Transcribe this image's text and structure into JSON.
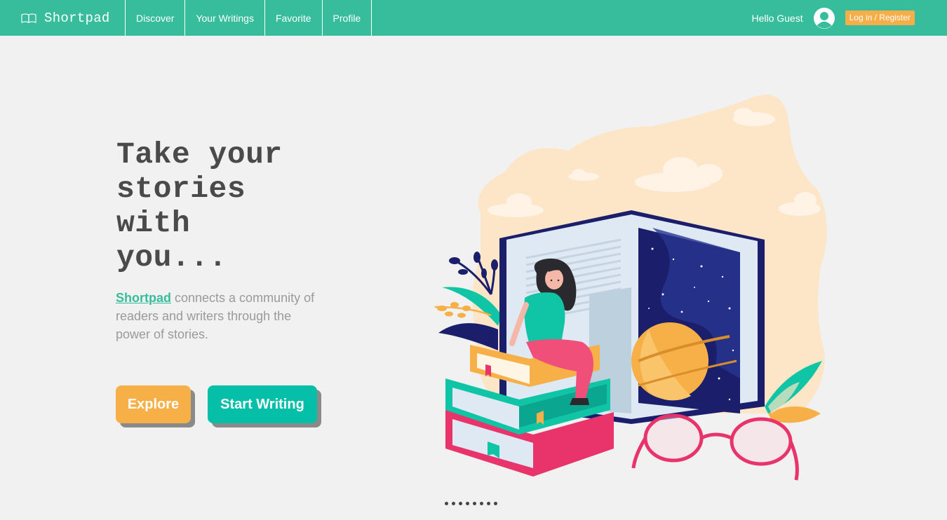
{
  "navbar": {
    "brand": "Shortpad",
    "brand_icon": "open-book-icon",
    "links": [
      "Discover",
      "Your Writings",
      "Favorite",
      "Profile"
    ],
    "greeting": "Hello Guest",
    "avatar_icon": "user-avatar-icon",
    "login_label": "Log in / Register",
    "accent_color": "#37bd9b",
    "login_color": "#f7ae48"
  },
  "hero": {
    "title_lines": [
      "Take your",
      "stories",
      "with",
      "you..."
    ],
    "desc_brand": "Shortpad",
    "desc_rest": " connects a community of readers and writers through the power of stories.",
    "explore_label": "Explore",
    "write_label": "Start Writing",
    "explore_color": "#f7b047",
    "write_color": "#05bfa8"
  },
  "illustration": {
    "description_icon": "reading-girl-illustration"
  },
  "pager": {
    "count": 8,
    "active_index": 0
  }
}
